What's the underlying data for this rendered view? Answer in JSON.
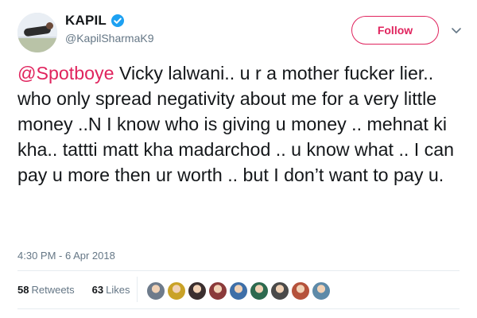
{
  "profile": {
    "display_name": "KAPIL",
    "handle": "@KapilSharmaK9",
    "follow_label": "Follow"
  },
  "tweet": {
    "mention": "@Spotboye",
    "text": " Vicky lalwani.. u r a mother fucker lier.. who only spread negativity about me for a very little money ..N I know who is giving u money .. mehnat ki kha.. tattti matt kha madarchod .. u know what ..  I can pay u more then ur worth .. but I don’t want to pay u.",
    "timestamp": "4:30 PM - 6 Apr 2018"
  },
  "stats": {
    "retweets_count": "58",
    "retweets_label": "Retweets",
    "likes_count": "63",
    "likes_label": "Likes"
  },
  "likers": [
    {
      "name": "liker-avatar-1",
      "color": "#6e7b8b"
    },
    {
      "name": "liker-avatar-2",
      "color": "#c9a227"
    },
    {
      "name": "liker-avatar-3",
      "color": "#3b2f2f"
    },
    {
      "name": "liker-avatar-4",
      "color": "#8b3a3a"
    },
    {
      "name": "liker-avatar-5",
      "color": "#3e6fa8"
    },
    {
      "name": "liker-avatar-6",
      "color": "#2d6a4f"
    },
    {
      "name": "liker-avatar-7",
      "color": "#4a4a4a"
    },
    {
      "name": "liker-avatar-8",
      "color": "#b5523b"
    },
    {
      "name": "liker-avatar-9",
      "color": "#5d8aa8"
    }
  ],
  "colors": {
    "accent": "#e0245e",
    "verified": "#1da1f2",
    "muted": "#657786"
  }
}
